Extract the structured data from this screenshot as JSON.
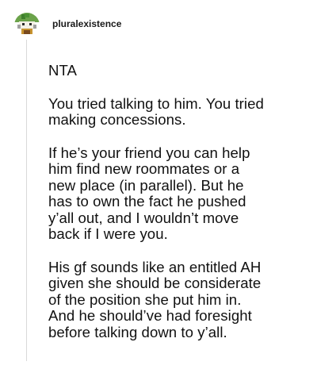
{
  "post": {
    "username": "pluralexistence",
    "avatar_icon": "cactus-avatar-icon",
    "paragraphs": [
      "NTA",
      "You tried talking to him. You tried\nmaking concessions.",
      "If he’s your friend you can help\nhim find new roommates or a\nnew place (in parallel). But he\nhas to own the fact he pushed\ny’all out, and I wouldn’t move\nback if I were you.",
      "His gf sounds like an entitled AH\ngiven she should be considerate\nof the position she put him in.\nAnd he should’ve had foresight\nbefore talking down to y’all."
    ]
  }
}
